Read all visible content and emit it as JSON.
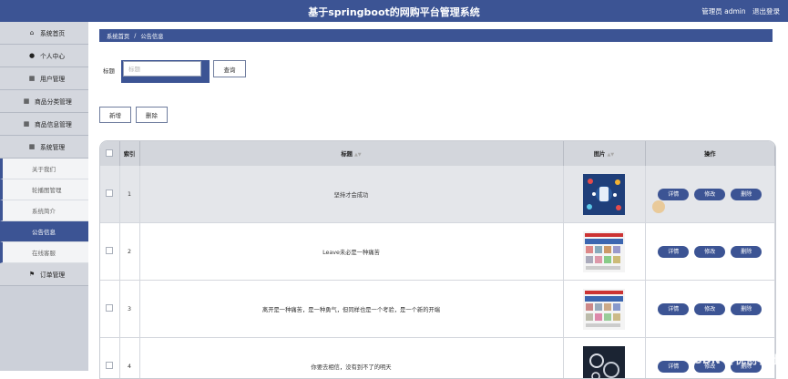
{
  "header": {
    "title": "基于springboot的网购平台管理系统",
    "user_label": "管理员 admin",
    "logout_label": "退出登录"
  },
  "sidebar": {
    "items": [
      {
        "icon": "home-icon",
        "label": "系统首页"
      },
      {
        "icon": "person-icon",
        "label": "个人中心"
      },
      {
        "icon": "grid-icon",
        "label": "用户管理"
      },
      {
        "icon": "grid-icon",
        "label": "商品分类管理"
      },
      {
        "icon": "grid-icon",
        "label": "商品信息管理"
      },
      {
        "icon": "grid-icon",
        "label": "系统管理"
      }
    ],
    "sub_items": [
      "关于我们",
      "轮播图管理",
      "系统简介",
      "公告信息",
      "在线客服"
    ],
    "active_sub": "公告信息",
    "last_item": {
      "icon": "flag-icon",
      "label": "订单管理"
    }
  },
  "breadcrumb": {
    "home": "系统首页",
    "separator": "/",
    "current": "公告信息"
  },
  "search": {
    "label": "标题",
    "placeholder": "标题",
    "query_button": "查询"
  },
  "actions": {
    "add": "新增",
    "delete": "删除"
  },
  "table": {
    "headers": {
      "index": "索引",
      "title": "标题",
      "image": "图片",
      "operation": "操作"
    },
    "rows": [
      {
        "index": "1",
        "title": "坚持才会成功"
      },
      {
        "index": "2",
        "title": "Leave未必是一种痛苦"
      },
      {
        "index": "3",
        "title": "离开是一种痛苦，是一种勇气，但同样也是一个考验，是一个新的开端"
      },
      {
        "index": "4",
        "title": "你要去相信，没有到不了的明天"
      }
    ],
    "row_buttons": {
      "detail": "详情",
      "edit": "修改",
      "delete": "删除"
    }
  },
  "watermark": "CSDN @优创学社",
  "colors": {
    "primary": "#3c5494",
    "sidebar_bg": "#ccd0d9"
  }
}
